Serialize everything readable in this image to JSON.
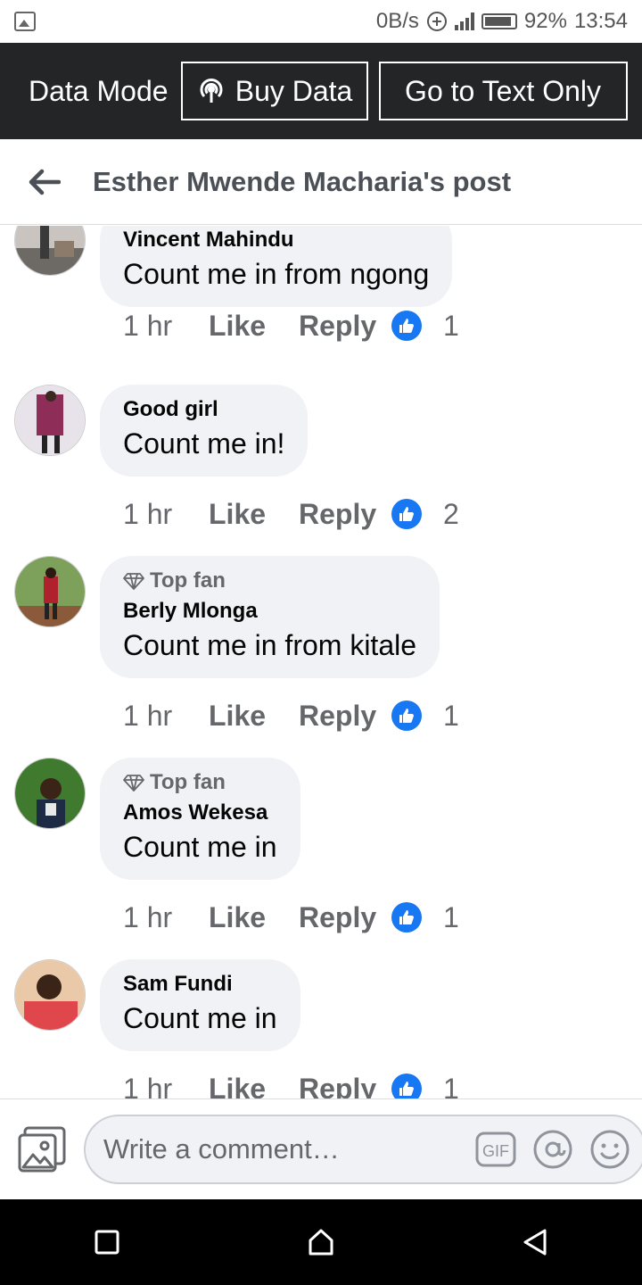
{
  "status_bar": {
    "network_speed": "0B/s",
    "battery": "92%",
    "time": "13:54",
    "battery_level": 0.92
  },
  "data_bar": {
    "label": "Data Mode",
    "buy_data": "Buy Data",
    "text_only": "Go to Text Only"
  },
  "header": {
    "title": "Esther Mwende Macharia's post"
  },
  "comments": [
    {
      "name": "Vincent Mahindu",
      "text": "Count me in from ngong",
      "top_fan": "",
      "time": "1 hr",
      "like": "Like",
      "reply": "Reply",
      "reactions": "1"
    },
    {
      "name": "Good girl",
      "text": "Count me in!",
      "top_fan": "",
      "time": "1 hr",
      "like": "Like",
      "reply": "Reply",
      "reactions": "2"
    },
    {
      "name": "Berly Mlonga",
      "text": "Count me in from kitale",
      "top_fan": "Top fan",
      "time": "1 hr",
      "like": "Like",
      "reply": "Reply",
      "reactions": "1"
    },
    {
      "name": "Amos Wekesa",
      "text": "Count me in",
      "top_fan": "Top fan",
      "time": "1 hr",
      "like": "Like",
      "reply": "Reply",
      "reactions": "1"
    },
    {
      "name": "Sam Fundi",
      "text": "Count me in",
      "top_fan": "",
      "time": "1 hr",
      "like": "Like",
      "reply": "Reply",
      "reactions": "1"
    }
  ],
  "composer": {
    "placeholder": "Write a comment…",
    "gif": "GIF"
  },
  "colors": {
    "accent": "#1877f2",
    "databar": "#242526",
    "bubble": "#f0f2f5"
  }
}
